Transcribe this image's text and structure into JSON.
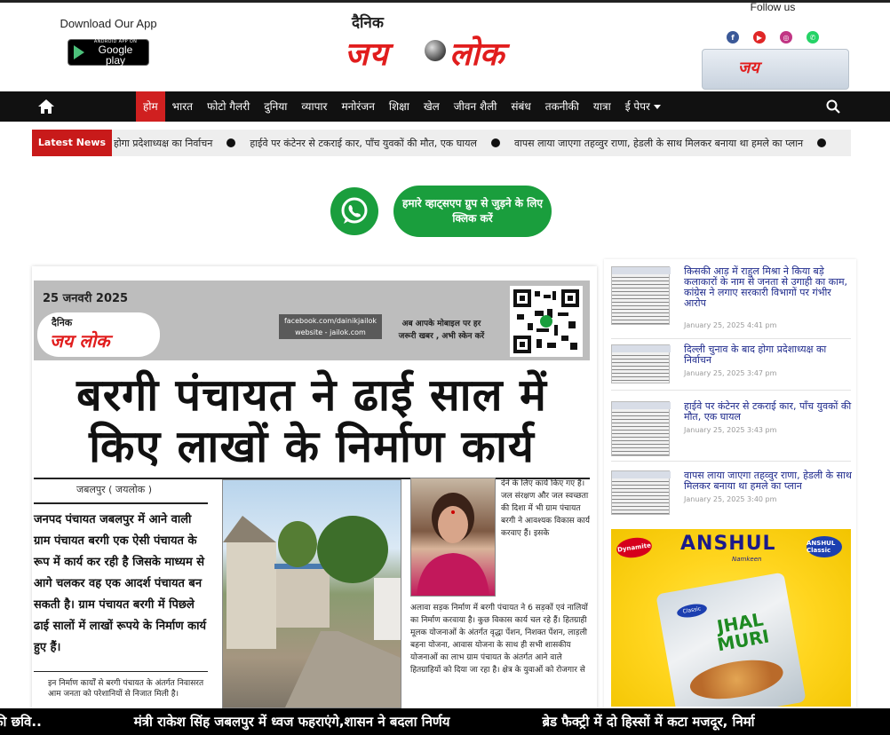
{
  "header": {
    "app_title": "Download Our App",
    "gplay_small": "ANDROID APP ON",
    "gplay_big": "Google play",
    "logo_small": "दैनिक",
    "logo_jay": "जय",
    "logo_lok": "लोक",
    "follow_label": "Follow us",
    "social": [
      "facebook-icon",
      "youtube-icon",
      "instagram-icon",
      "whatsapp-icon"
    ],
    "social_colors": [
      "#3b5998",
      "#e02626",
      "#c13584",
      "#25d366"
    ]
  },
  "nav": {
    "items": [
      "होम",
      "भारत",
      "फोटो गैलरी",
      "दुनिया",
      "व्यापार",
      "मनोरंजन",
      "शिक्षा",
      "खेल",
      "जीवन शैली",
      "संबंध",
      "तकनीकी",
      "यात्रा",
      "ई पेपर"
    ],
    "active": "होम"
  },
  "ticker": {
    "label": "Latest News",
    "items": [
      "होगा प्रदेशाध्यक्ष का निर्वाचन",
      "हाईवे पर कंटेनर से टकराई कार, पाँच युवकों की मौत, एक घायल",
      "वापस लाया जाएगा तहव्वुर राणा, हेडली के साथ मिलकर बनाया था हमले का प्लान"
    ]
  },
  "whatsapp": {
    "cta": "हमारे व्हाट्सएप ग्रुप से जुड़ने के लिए क्लिक करें",
    "accent": "#1a9e3d"
  },
  "clipping": {
    "date": "25 जनवरी 2025",
    "logo_small": "दैनिक",
    "logo_main": "जय लोक",
    "facebook": "facebook.com/dainikjailok",
    "website": "website - jailok.com",
    "mobile_line1": "अब आपके मोबाइल पर हर",
    "mobile_line2": "जरूरी खबर , अभी स्केन करें",
    "headline_line1": "बरगी पंचायत ने ढाई साल में",
    "headline_line2": "किए लाखों के निर्माण कार्य",
    "dateline": "जबलपुर ( जयलोक )",
    "lead": "जनपद पंचायत जबलपुर में आने वाली ग्राम पंचायत बरगी एक ऐसी पंचायत के रूप में कार्य कर रही है जिसके माध्यम से आगे चलकर वह एक आदर्श पंचायत बन सकती है। ग्राम पंचायत बरगी में पिछले ढाई सालों में लाखों रूपये के निर्माण कार्य हुए हैं।",
    "body": "इन निर्माण कार्यों से बरगी पंचायत के अंतर्गत निवासरत आम जनता को परेशानियों से निजात मिली है।",
    "side_text": "देने के लिए कार्य किए गए हैं। जल संरक्षण और जल स्वच्छता की दिशा में भी ग्राम पंचायत बरगी ने आवश्यक विकास कार्य करवाए हैं। इसके",
    "lower_text": "अलावा सड़क निर्माण में बरगी पंचायत ने 6 सड़कों एवं नालियों का निर्माण करवाया है। कुछ विकास कार्य चल रहे हैं। हितग्राही मूलक योजनाओं के अंतर्गत वृद्धा पेंशन, निशक्त पेंशन, लाड़ली बहना योजना, आवास योजना के साथ ही सभी शासकीय योजनाओं का लाभ ग्राम पंचायत के अंतर्गत आने वाले हितग्राहियों को दिया जा रहा है। क्षेत्र के युवाओं को रोजगार से"
  },
  "sidebar": {
    "items": [
      {
        "title": "किसकी आड़ में राहुल मिश्रा ने किया बड़े कलाकारों के नाम से जनता से उगाही का काम, कांग्रेस ने लगाए सरकारी विभागों पर गंभीर आरोप",
        "date": "January 25, 2025 4:41 pm"
      },
      {
        "title": "दिल्ली चुनाव के बाद होगा प्रदेशाध्यक्ष का निर्वाचन",
        "date": "January 25, 2025 3:47 pm"
      },
      {
        "title": "हाईवे पर कंटेनर से टकराई कार, पाँच युवकों की मौत, एक घायल",
        "date": "January 25, 2025 3:43 pm"
      },
      {
        "title": "वापस लाया जाएगा तहव्वुर राणा, हेडली के साथ मिलकर बनाया था हमले का प्लान",
        "date": "January 25, 2025 3:40 pm"
      }
    ],
    "ad": {
      "brand": "ANSHUL",
      "sub": "Namkeen",
      "left_badge": "Dynamite",
      "right_badge": "ANSHUL Classic",
      "pack_badge": "Classic",
      "pack_name": "JHAL MURI"
    }
  },
  "marquee": {
    "items": [
      "की छवि..",
      "मंत्री राकेश सिंह जबलपुर में ध्वज फहराएंगे,शासन ने बदला निर्णय",
      "ब्रेड फैक्ट्री में दो हिस्सों में कटा मजदूर, निर्मा"
    ]
  }
}
